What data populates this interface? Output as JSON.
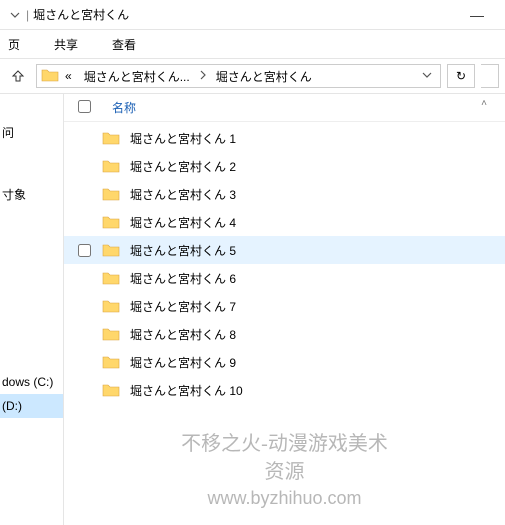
{
  "titlebar": {
    "sep": "|",
    "title": "堀さんと宮村くん",
    "minimize": "—"
  },
  "tabs": {
    "home_partial": "页",
    "share": "共享",
    "view": "查看"
  },
  "addressbar": {
    "prefix": "«",
    "crumb1": "堀さんと宮村くん...",
    "crumb2": "堀さんと宮村くん"
  },
  "navpane": {
    "item1_partial": "问",
    "item2": "",
    "item3_partial": "寸象",
    "item4": "",
    "drive1_partial": "dows (C:)",
    "drive2_partial": "(D:)"
  },
  "header": {
    "name_col": "名称"
  },
  "items": [
    {
      "name": "堀さんと宮村くん 1",
      "hovered": false
    },
    {
      "name": "堀さんと宮村くん 2",
      "hovered": false
    },
    {
      "name": "堀さんと宮村くん 3",
      "hovered": false
    },
    {
      "name": "堀さんと宮村くん 4",
      "hovered": false
    },
    {
      "name": "堀さんと宮村くん 5",
      "hovered": true
    },
    {
      "name": "堀さんと宮村くん 6",
      "hovered": false
    },
    {
      "name": "堀さんと宮村くん 7",
      "hovered": false
    },
    {
      "name": "堀さんと宮村くん 8",
      "hovered": false
    },
    {
      "name": "堀さんと宮村くん 9",
      "hovered": false
    },
    {
      "name": "堀さんと宮村くん 10",
      "hovered": false
    }
  ],
  "watermark": {
    "line1": "不移之火-动漫游戏美术资源",
    "line2": "www.byzhihuo.com"
  },
  "icons": {
    "refresh": "↻"
  }
}
